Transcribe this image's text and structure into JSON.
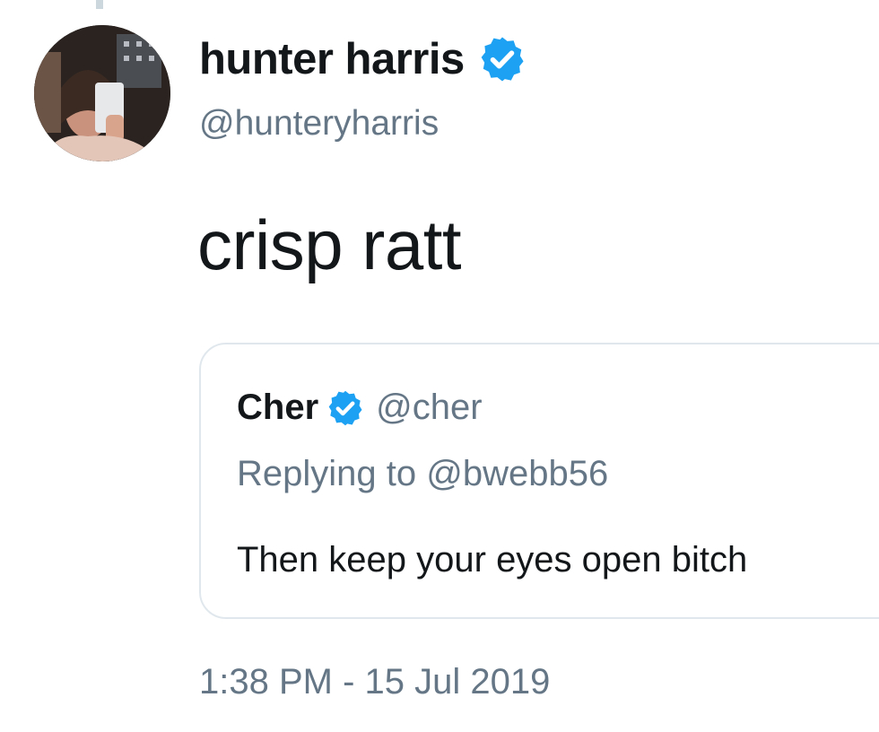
{
  "tweet": {
    "author": {
      "display_name": "hunter harris",
      "handle": "@hunteryharris",
      "verified": true,
      "verified_icon": "verified-badge-icon"
    },
    "text": "crisp ratt",
    "quoted_tweet": {
      "author_name": "Cher",
      "author_handle": "@cher",
      "verified": true,
      "replying_prefix": "Replying to ",
      "replying_to": "@bwebb56",
      "text": "Then keep your eyes open bitch"
    },
    "timestamp": "1:38 PM - 15 Jul 2019"
  },
  "colors": {
    "verified_blue": "#1da1f2",
    "secondary_text": "#657786",
    "primary_text": "#14171a",
    "card_border": "#e1e8ed"
  }
}
